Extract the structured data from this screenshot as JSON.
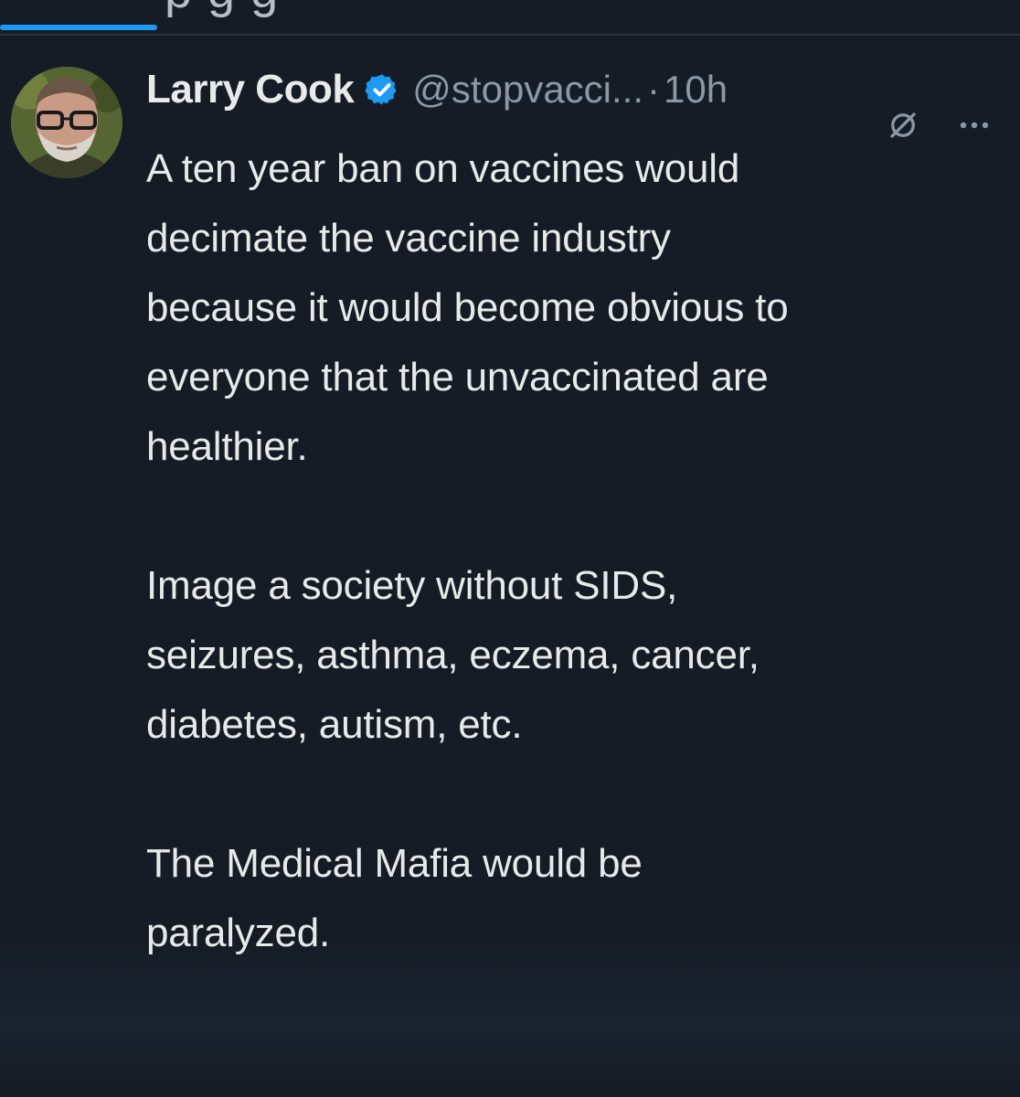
{
  "tabs": {
    "cut_off_text": "p              g  g"
  },
  "tweet": {
    "author": {
      "name": "Larry Cook",
      "handle": "@stopvacci...",
      "verified": true
    },
    "separator": "·",
    "timestamp": "10h",
    "paragraphs": [
      "A ten year ban on vaccines would\ndecimate the vaccine industry\nbecause it would become obvious to\neveryone that the unvaccinated are\nhealthier.",
      "Image a society without SIDS,\nseizures, asthma, eczema, cancer,\ndiabetes, autism, etc.",
      "The Medical Mafia would be\nparalyzed."
    ]
  },
  "icons": {
    "verified": "verified-badge-icon",
    "grok": "grok-icon",
    "more": "more-options-icon"
  },
  "colors": {
    "background": "#151c26",
    "text": "#e7e9ea",
    "muted": "#8b98a5",
    "accent": "#1d9bf0"
  }
}
